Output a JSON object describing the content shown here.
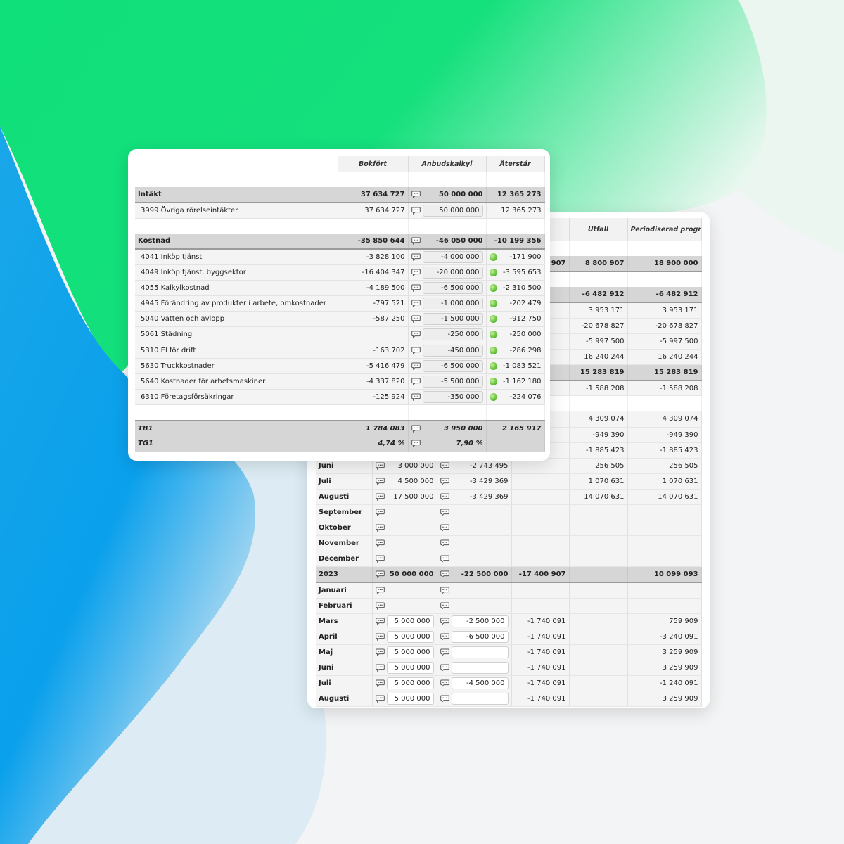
{
  "theme": {
    "green": "#16e07a",
    "blue": "#0aa0ec",
    "indicator": "#6cc640"
  },
  "summary_table": {
    "headers": [
      "Bokfört",
      "Anbudskalkyl",
      "Återstår"
    ],
    "groups": [
      {
        "label": "Intäkt",
        "bokfort": "37 634 727",
        "anbud": "50 000 000",
        "aterstar": "12 365 273",
        "rows": [
          {
            "label": "3999 Övriga rörelseintäkter",
            "bokfort": "37 634 727",
            "anbud": "50 000 000",
            "aterstar": "12 365 273",
            "dot": false
          }
        ]
      },
      {
        "label": "Kostnad",
        "bokfort": "-35 850 644",
        "anbud": "-46 050 000",
        "aterstar": "-10 199 356",
        "rows": [
          {
            "label": "4041 Inköp tjänst",
            "bokfort": "-3 828 100",
            "anbud": "-4 000 000",
            "aterstar": "-171 900",
            "dot": true
          },
          {
            "label": "4049 Inköp tjänst, byggsektor",
            "bokfort": "-16 404 347",
            "anbud": "-20 000 000",
            "aterstar": "-3 595 653",
            "dot": true
          },
          {
            "label": "4055 Kalkylkostnad",
            "bokfort": "-4 189 500",
            "anbud": "-6 500 000",
            "aterstar": "-2 310 500",
            "dot": true
          },
          {
            "label": "4945 Förändring av produkter i arbete, omkostnader",
            "bokfort": "-797 521",
            "anbud": "-1 000 000",
            "aterstar": "-202 479",
            "dot": true
          },
          {
            "label": "5040 Vatten och avlopp",
            "bokfort": "-587 250",
            "anbud": "-1 500 000",
            "aterstar": "-912 750",
            "dot": true
          },
          {
            "label": "5061 Städning",
            "bokfort": "",
            "anbud": "-250 000",
            "aterstar": "-250 000",
            "dot": true
          },
          {
            "label": "5310 El för drift",
            "bokfort": "-163 702",
            "anbud": "-450 000",
            "aterstar": "-286 298",
            "dot": true
          },
          {
            "label": "5630 Truckkostnader",
            "bokfort": "-5 416 479",
            "anbud": "-6 500 000",
            "aterstar": "-1 083 521",
            "dot": true
          },
          {
            "label": "5640 Kostnader för arbetsmaskiner",
            "bokfort": "-4 337 820",
            "anbud": "-5 500 000",
            "aterstar": "-1 162 180",
            "dot": true
          },
          {
            "label": "6310 Företagsförsäkringar",
            "bokfort": "-125 924",
            "anbud": "-350 000",
            "aterstar": "-224 076",
            "dot": true
          }
        ]
      }
    ],
    "totals": [
      {
        "label": "TB1",
        "bokfort": "1 784 083",
        "anbud": "3 950 000",
        "aterstar": "2 165 917"
      },
      {
        "label": "TG1",
        "bokfort": "4,74 %",
        "anbud": "7,90 %",
        "aterstar": ""
      }
    ]
  },
  "forecast_table": {
    "headers": [
      "",
      "",
      "",
      "",
      "Utfall",
      "Periodiserad prognos"
    ],
    "rows": [
      {
        "type": "blank"
      },
      {
        "type": "grp",
        "label": "",
        "s1": "",
        "s2": "",
        "s3": "907",
        "s4": "8 800 907",
        "s5": "18 900 000"
      },
      {
        "type": "blank"
      },
      {
        "type": "grp",
        "label": "",
        "s1": "",
        "s2": "",
        "s3": "",
        "s4": "-6 482 912",
        "s5": "-6 482 912"
      },
      {
        "type": "row",
        "label": "",
        "s1": "",
        "s2": "",
        "s3": "",
        "s4": "3 953 171",
        "s5": "3 953 171"
      },
      {
        "type": "row",
        "label": "",
        "s1": "",
        "s2": "",
        "s3": "",
        "s4": "-20 678 827",
        "s5": "-20 678 827"
      },
      {
        "type": "row",
        "label": "",
        "s1": "",
        "s2": "",
        "s3": "",
        "s4": "-5 997 500",
        "s5": "-5 997 500"
      },
      {
        "type": "row",
        "label": "",
        "s1": "",
        "s2": "",
        "s3": "",
        "s4": "16 240 244",
        "s5": "16 240 244"
      },
      {
        "type": "grp",
        "label": "",
        "s1": "",
        "s2": "",
        "s3": "",
        "s4": "15 283 819",
        "s5": "15 283 819"
      },
      {
        "type": "row",
        "label": "",
        "s1": "",
        "s2": "",
        "s3": "",
        "s4": "-1 588 208",
        "s5": "-1 588 208"
      },
      {
        "type": "blank"
      },
      {
        "type": "row",
        "label": "",
        "s1": "",
        "s2": "",
        "s3": "",
        "s4": "4 309 074",
        "s5": "4 309 074"
      },
      {
        "type": "row",
        "label": "",
        "s1": "",
        "s2": "",
        "s3": "",
        "s4": "-949 390",
        "s5": "-949 390"
      },
      {
        "type": "row",
        "label": "",
        "s1": "",
        "s2": "",
        "s3": "",
        "s4": "-1 885 423",
        "s5": "-1 885 423"
      },
      {
        "type": "row",
        "label": "Juni",
        "cmt": true,
        "s1": "3 000 000",
        "s2": "-2 743 495",
        "s3": "",
        "s4": "256 505",
        "s5": "256 505"
      },
      {
        "type": "row",
        "label": "Juli",
        "cmt": true,
        "s1": "4 500 000",
        "s2": "-3 429 369",
        "s3": "",
        "s4": "1 070 631",
        "s5": "1 070 631"
      },
      {
        "type": "row",
        "label": "Augusti",
        "cmt": true,
        "s1": "17 500 000",
        "s2": "-3 429 369",
        "s3": "",
        "s4": "14 070 631",
        "s5": "14 070 631"
      },
      {
        "type": "row",
        "label": "September",
        "cmt": true,
        "s1": "",
        "s2": "",
        "s3": "",
        "s4": "",
        "s5": ""
      },
      {
        "type": "row",
        "label": "Oktober",
        "cmt": true,
        "s1": "",
        "s2": "",
        "s3": "",
        "s4": "",
        "s5": ""
      },
      {
        "type": "row",
        "label": "November",
        "cmt": true,
        "s1": "",
        "s2": "",
        "s3": "",
        "s4": "",
        "s5": ""
      },
      {
        "type": "row",
        "label": "December",
        "cmt": true,
        "s1": "",
        "s2": "",
        "s3": "",
        "s4": "",
        "s5": ""
      },
      {
        "type": "grp",
        "label": "2023",
        "cmt": true,
        "s1": "50 000 000",
        "s2": "-22 500 000",
        "s3": "-17 400 907",
        "s4": "",
        "s5": "10 099 093"
      },
      {
        "type": "row",
        "label": "Januari",
        "cmt": true,
        "s1": "",
        "s2": "",
        "s3": "",
        "s4": "",
        "s5": ""
      },
      {
        "type": "row",
        "label": "Februari",
        "cmt": true,
        "s1": "",
        "s2": "",
        "s3": "",
        "s4": "",
        "s5": ""
      },
      {
        "type": "row",
        "label": "Mars",
        "cmt": true,
        "inputs": true,
        "s1": "5 000 000",
        "s2": "-2 500 000",
        "s3": "-1 740 091",
        "s4": "",
        "s5": "759 909"
      },
      {
        "type": "row",
        "label": "April",
        "cmt": true,
        "inputs": true,
        "s1": "5 000 000",
        "s2": "-6 500 000",
        "s3": "-1 740 091",
        "s4": "",
        "s5": "-3 240 091"
      },
      {
        "type": "row",
        "label": "Maj",
        "cmt": true,
        "inputs": true,
        "s1": "5 000 000",
        "s2": "",
        "s3": "-1 740 091",
        "s4": "",
        "s5": "3 259 909"
      },
      {
        "type": "row",
        "label": "Juni",
        "cmt": true,
        "inputs": true,
        "s1": "5 000 000",
        "s2": "",
        "s3": "-1 740 091",
        "s4": "",
        "s5": "3 259 909"
      },
      {
        "type": "row",
        "label": "Juli",
        "cmt": true,
        "inputs": true,
        "s1": "5 000 000",
        "s2": "-4 500 000",
        "s3": "-1 740 091",
        "s4": "",
        "s5": "-1 240 091"
      },
      {
        "type": "row",
        "label": "Augusti",
        "cmt": true,
        "inputs": true,
        "s1": "5 000 000",
        "s2": "",
        "s3": "-1 740 091",
        "s4": "",
        "s5": "3 259 909"
      }
    ]
  }
}
